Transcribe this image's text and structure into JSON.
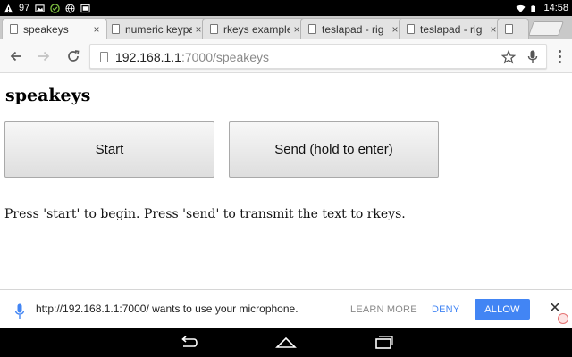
{
  "status_bar": {
    "notification_count": "97",
    "time": "14:58"
  },
  "tabs": [
    {
      "title": "speakeys",
      "active": true
    },
    {
      "title": "numeric keypad",
      "active": false
    },
    {
      "title": "rkeys example",
      "active": false
    },
    {
      "title": "teslapad - rig",
      "active": false
    },
    {
      "title": "teslapad - rig",
      "active": false
    },
    {
      "title": "",
      "active": false
    }
  ],
  "toolbar": {
    "url_host": "192.168.1.1",
    "url_path": ":7000/speakeys"
  },
  "page": {
    "title": "speakeys",
    "start_label": "Start",
    "send_label": "Send (hold to enter)",
    "instructions": "Press 'start' to begin. Press 'send' to transmit the text to rkeys."
  },
  "infobar": {
    "message": "http://192.168.1.1:7000/ wants to use your microphone.",
    "learn_more": "LEARN MORE",
    "deny": "DENY",
    "allow": "ALLOW"
  },
  "icons": {
    "tab_close": "×",
    "infobar_close": "✕"
  },
  "colors": {
    "accent_blue": "#4285f4",
    "status_bar": "#000000"
  }
}
